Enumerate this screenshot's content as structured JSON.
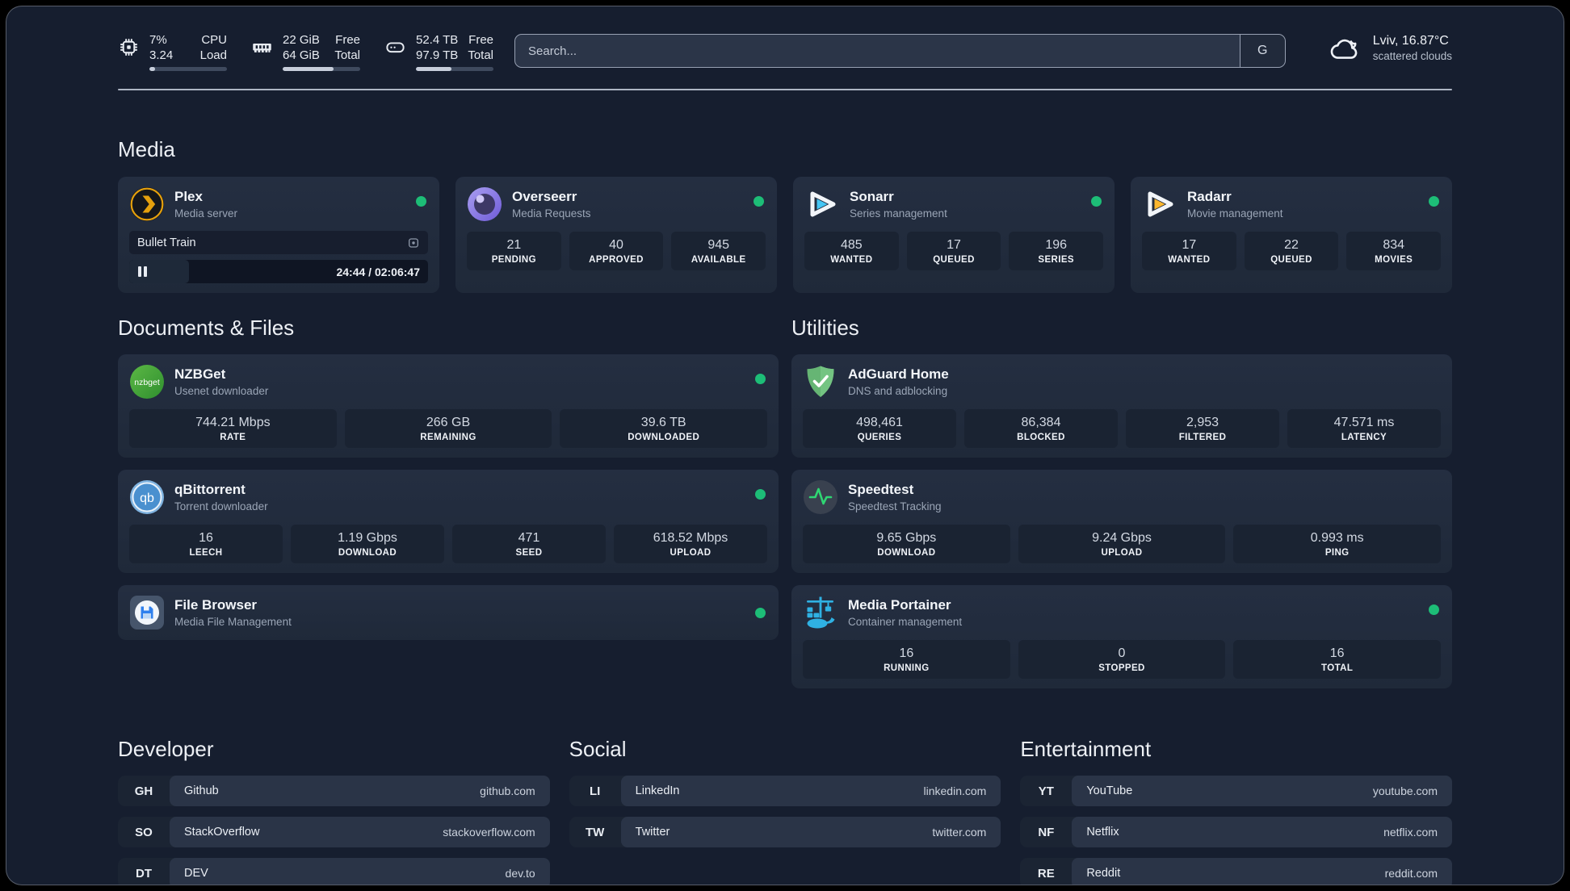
{
  "header": {
    "system": [
      {
        "v1": "7%",
        "v2": "3.24",
        "l1": "CPU",
        "l2": "Load",
        "progress_pct": 7
      },
      {
        "v1": "22 GiB",
        "v2": "64 GiB",
        "l1": "Free",
        "l2": "Total",
        "progress_pct": 66
      },
      {
        "v1": "52.4 TB",
        "v2": "97.9 TB",
        "l1": "Free",
        "l2": "Total",
        "progress_pct": 46
      }
    ],
    "search": {
      "placeholder": "Search...",
      "button_label": "G"
    },
    "weather": {
      "location": "Lviv, 16.87°C",
      "condition": "scattered clouds"
    }
  },
  "media": {
    "title": "Media",
    "plex": {
      "name": "Plex",
      "subtitle": "Media server",
      "now_playing": {
        "title": "Bullet Train",
        "time": "24:44 / 02:06:47",
        "progress_pct": 20
      }
    },
    "overseerr": {
      "name": "Overseerr",
      "subtitle": "Media Requests",
      "stats": [
        {
          "value": "21",
          "label": "PENDING"
        },
        {
          "value": "40",
          "label": "APPROVED"
        },
        {
          "value": "945",
          "label": "AVAILABLE"
        }
      ]
    },
    "sonarr": {
      "name": "Sonarr",
      "subtitle": "Series management",
      "stats": [
        {
          "value": "485",
          "label": "WANTED"
        },
        {
          "value": "17",
          "label": "QUEUED"
        },
        {
          "value": "196",
          "label": "SERIES"
        }
      ]
    },
    "radarr": {
      "name": "Radarr",
      "subtitle": "Movie management",
      "stats": [
        {
          "value": "17",
          "label": "WANTED"
        },
        {
          "value": "22",
          "label": "QUEUED"
        },
        {
          "value": "834",
          "label": "MOVIES"
        }
      ]
    }
  },
  "documents": {
    "title": "Documents & Files",
    "nzbget": {
      "name": "NZBGet",
      "subtitle": "Usenet downloader",
      "stats": [
        {
          "value": "744.21 Mbps",
          "label": "RATE"
        },
        {
          "value": "266 GB",
          "label": "REMAINING"
        },
        {
          "value": "39.6 TB",
          "label": "DOWNLOADED"
        }
      ]
    },
    "qbittorrent": {
      "name": "qBittorrent",
      "subtitle": "Torrent downloader",
      "stats": [
        {
          "value": "16",
          "label": "LEECH"
        },
        {
          "value": "1.19 Gbps",
          "label": "DOWNLOAD"
        },
        {
          "value": "471",
          "label": "SEED"
        },
        {
          "value": "618.52 Mbps",
          "label": "UPLOAD"
        }
      ]
    },
    "filebrowser": {
      "name": "File Browser",
      "subtitle": "Media File Management"
    }
  },
  "utilities": {
    "title": "Utilities",
    "adguard": {
      "name": "AdGuard Home",
      "subtitle": "DNS and adblocking",
      "stats": [
        {
          "value": "498,461",
          "label": "QUERIES"
        },
        {
          "value": "86,384",
          "label": "BLOCKED"
        },
        {
          "value": "2,953",
          "label": "FILTERED"
        },
        {
          "value": "47.571 ms",
          "label": "LATENCY"
        }
      ]
    },
    "speedtest": {
      "name": "Speedtest",
      "subtitle": "Speedtest Tracking",
      "stats": [
        {
          "value": "9.65 Gbps",
          "label": "DOWNLOAD"
        },
        {
          "value": "9.24 Gbps",
          "label": "UPLOAD"
        },
        {
          "value": "0.993 ms",
          "label": "PING"
        }
      ]
    },
    "portainer": {
      "name": "Media Portainer",
      "subtitle": "Container management",
      "stats": [
        {
          "value": "16",
          "label": "RUNNING"
        },
        {
          "value": "0",
          "label": "STOPPED"
        },
        {
          "value": "16",
          "label": "TOTAL"
        }
      ]
    }
  },
  "bookmarks": [
    {
      "title": "Developer",
      "links": [
        {
          "abbr": "GH",
          "name": "Github",
          "url": "github.com"
        },
        {
          "abbr": "SO",
          "name": "StackOverflow",
          "url": "stackoverflow.com"
        },
        {
          "abbr": "DT",
          "name": "DEV",
          "url": "dev.to"
        }
      ]
    },
    {
      "title": "Social",
      "links": [
        {
          "abbr": "LI",
          "name": "LinkedIn",
          "url": "linkedin.com"
        },
        {
          "abbr": "TW",
          "name": "Twitter",
          "url": "twitter.com"
        }
      ]
    },
    {
      "title": "Entertainment",
      "links": [
        {
          "abbr": "YT",
          "name": "YouTube",
          "url": "youtube.com"
        },
        {
          "abbr": "NF",
          "name": "Netflix",
          "url": "netflix.com"
        },
        {
          "abbr": "RE",
          "name": "Reddit",
          "url": "reddit.com"
        }
      ]
    }
  ],
  "colors": {
    "status_online": "#1dbd77",
    "plex_gold": "#e5a00d",
    "sonarr_blue": "#45c6f4",
    "radarr_yellow": "#fdb72e",
    "adguard_green": "#66b574",
    "portainer_blue": "#2fb1e3",
    "speedtest_green": "#2fd673"
  }
}
